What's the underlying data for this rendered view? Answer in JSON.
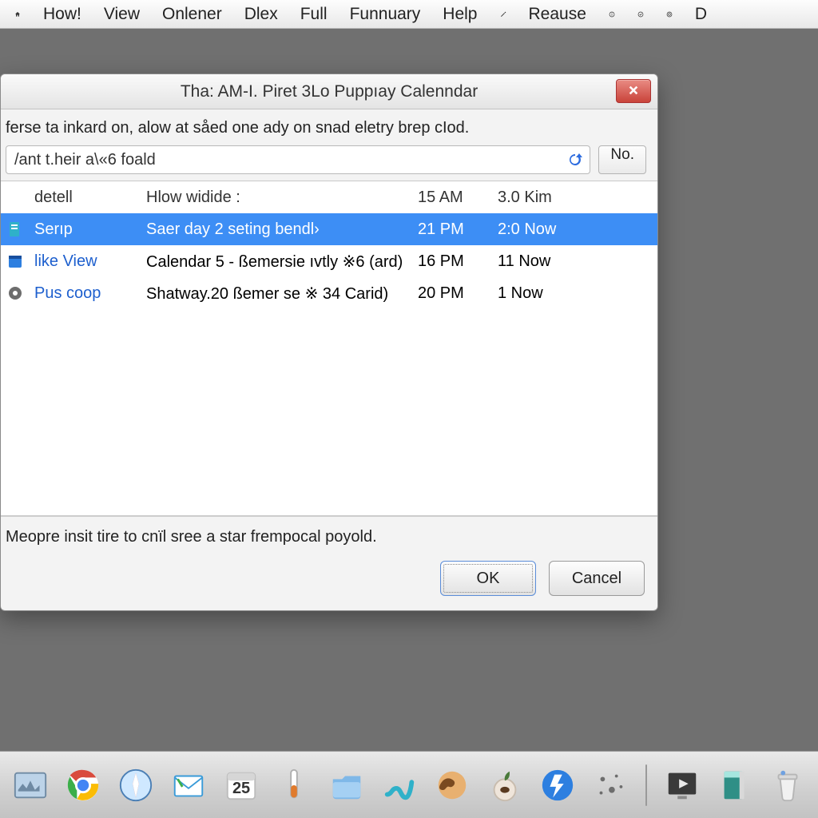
{
  "menubar": {
    "items": [
      "How!",
      "View",
      "Onlener",
      "Dlex",
      "Full",
      "Funnuary",
      "Help",
      "Reause",
      "D"
    ]
  },
  "dialog": {
    "title": "Tha: AM-I. Piret 3Lo Puppıay Calenndar",
    "description": "ferse ta inkard on, alow at såed one ady on snad eletry brep cIod.",
    "search_value": "/ant t.heir a\\«6 foald",
    "no_label": "No.",
    "columns": {
      "c1": "detell",
      "c2": "Hlow widide :",
      "c3": "15 AM",
      "c4": "3.0 Kim"
    },
    "rows": [
      {
        "icon": "doc",
        "name": "Serıp",
        "detail": "Saer day 2  seting bendl›",
        "time": "21 PM",
        "extra": "2:0 Now"
      },
      {
        "icon": "cal",
        "name": "like View",
        "detail": "Calendar 5 - ßemersie ıvtly ※6 (ard)",
        "time": "16 PM",
        "extra": "11 Now"
      },
      {
        "icon": "gear",
        "name": "Pus coop",
        "detail": "Shatway.20 ßemer se ﻿※ 34 Carid)",
        "time": "20 PM",
        "extra": "1 Now"
      }
    ],
    "hint": "Meopre insit tire to cnïl sree a star frempocal poyold.",
    "ok_label": "OK",
    "cancel_label": "Cancel"
  },
  "dock": {
    "calendar_day": "25"
  },
  "colors": {
    "selection": "#3d8ef5",
    "desktop": "#707070"
  }
}
